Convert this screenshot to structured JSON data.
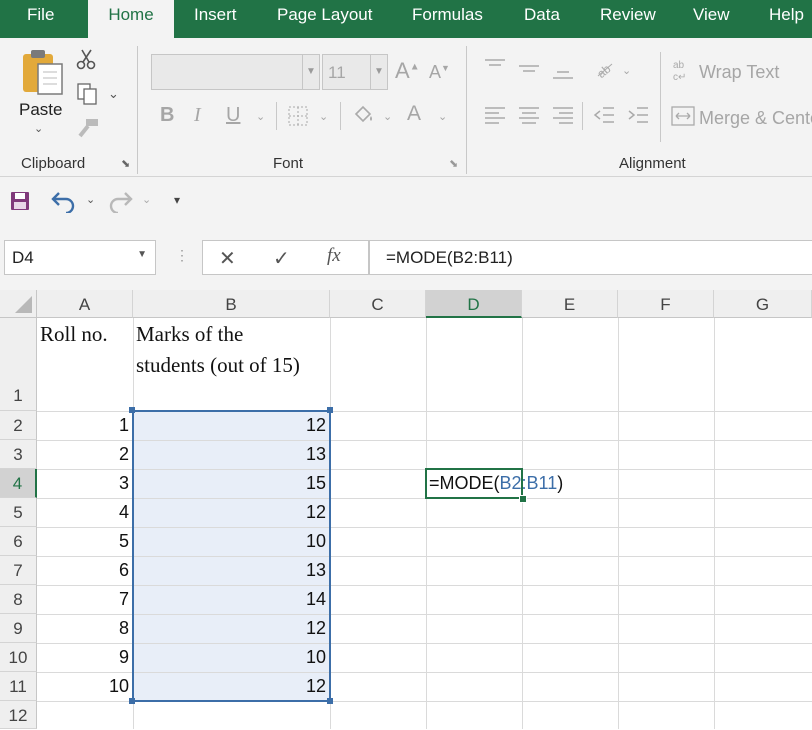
{
  "ribbon_tabs": [
    "File",
    "Home",
    "Insert",
    "Page Layout",
    "Formulas",
    "Data",
    "Review",
    "View",
    "Help"
  ],
  "clipboard": {
    "paste_label": "Paste",
    "group_label": "Clipboard"
  },
  "font": {
    "family_value": "",
    "size_value": "11",
    "group_label": "Font",
    "bold": "B",
    "italic": "I",
    "underline": "U",
    "grow": "A",
    "shrink": "A",
    "color": "A"
  },
  "alignment": {
    "wrap_text_label": "Wrap Text",
    "merge_label": "Merge & Cente",
    "group_label": "Alignment"
  },
  "formula_bar": {
    "name_box": "D4",
    "cancel": "✕",
    "enter": "✓",
    "fx": "fx",
    "formula": "=MODE(B2:B11)"
  },
  "columns": [
    "A",
    "B",
    "C",
    "D",
    "E",
    "F",
    "G"
  ],
  "rows": [
    "1",
    "2",
    "3",
    "4",
    "5",
    "6",
    "7",
    "8",
    "9",
    "10",
    "11",
    "12"
  ],
  "sheet": {
    "a1": "Roll no.",
    "b1_line1": "Marks of the",
    "b1_line2": "students (out of 15)",
    "roll_numbers": [
      "1",
      "2",
      "3",
      "4",
      "5",
      "6",
      "7",
      "8",
      "9",
      "10"
    ],
    "marks": [
      "12",
      "13",
      "15",
      "12",
      "10",
      "13",
      "14",
      "12",
      "10",
      "12"
    ],
    "d4_prefix": "=MODE(",
    "d4_ref": "B2:B11",
    "d4_suffix": ")"
  },
  "colors": {
    "excel_green": "#217346",
    "selection_fill": "#e8eef8",
    "range_border": "#3c6ea8",
    "ref_blue": "#3c6ea8"
  },
  "icons": [
    "paste-icon",
    "cut-icon",
    "copy-icon",
    "format-painter-icon",
    "save-icon",
    "undo-icon",
    "redo-icon",
    "customize-qat-icon",
    "wrap-text-icon",
    "merge-icon",
    "borders-icon",
    "fill-color-icon",
    "orientation-icon"
  ]
}
